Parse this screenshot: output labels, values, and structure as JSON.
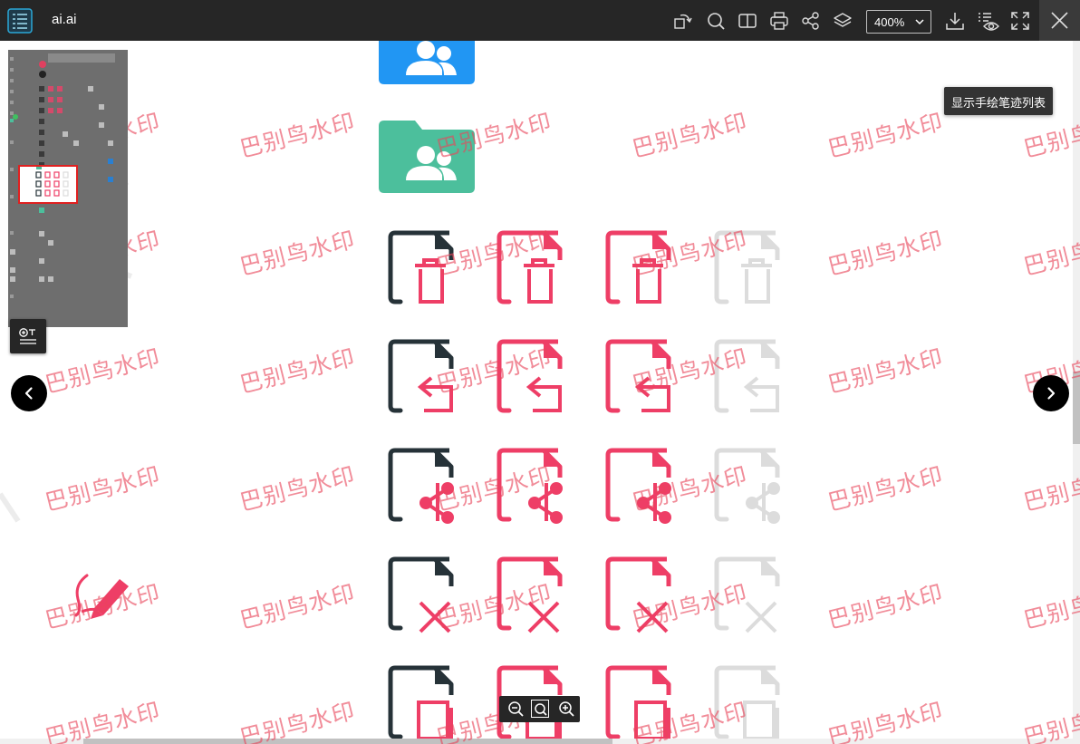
{
  "window": {
    "file_name": "ai.ai"
  },
  "toolbar": {
    "zoom_value": "400%",
    "buttons": [
      "rotate-icon",
      "search-icon",
      "split-view-icon",
      "print-icon",
      "share-icon",
      "layers-icon",
      "download-icon",
      "annotation-list-icon",
      "fullscreen-icon",
      "close-icon"
    ]
  },
  "tooltip": {
    "text": "显示手绘笔迹列表"
  },
  "watermark": {
    "text": "巴别鸟水印",
    "color": "#e8465a"
  },
  "colors": {
    "toolbar_bg": "#262626",
    "dark_icon": "#263238",
    "accent_red": "#ee3e66",
    "gray_icon": "#dcdcdc",
    "folder_blue": "#2196f3",
    "folder_green": "#4cbf9c"
  },
  "document_icons": {
    "columns": [
      "dark",
      "red",
      "red",
      "gray"
    ],
    "rows": [
      "file-delete-icon",
      "file-return-icon",
      "file-share-icon",
      "file-close-icon",
      "file-copy-icon"
    ],
    "folders": [
      "shared-folder-blue-icon",
      "shared-folder-green-icon"
    ]
  },
  "navigation": {
    "prev": "chevron-left-icon",
    "next": "chevron-right-icon"
  },
  "zoom_controls": [
    "zoom-out-icon",
    "zoom-fit-icon",
    "zoom-in-icon"
  ]
}
